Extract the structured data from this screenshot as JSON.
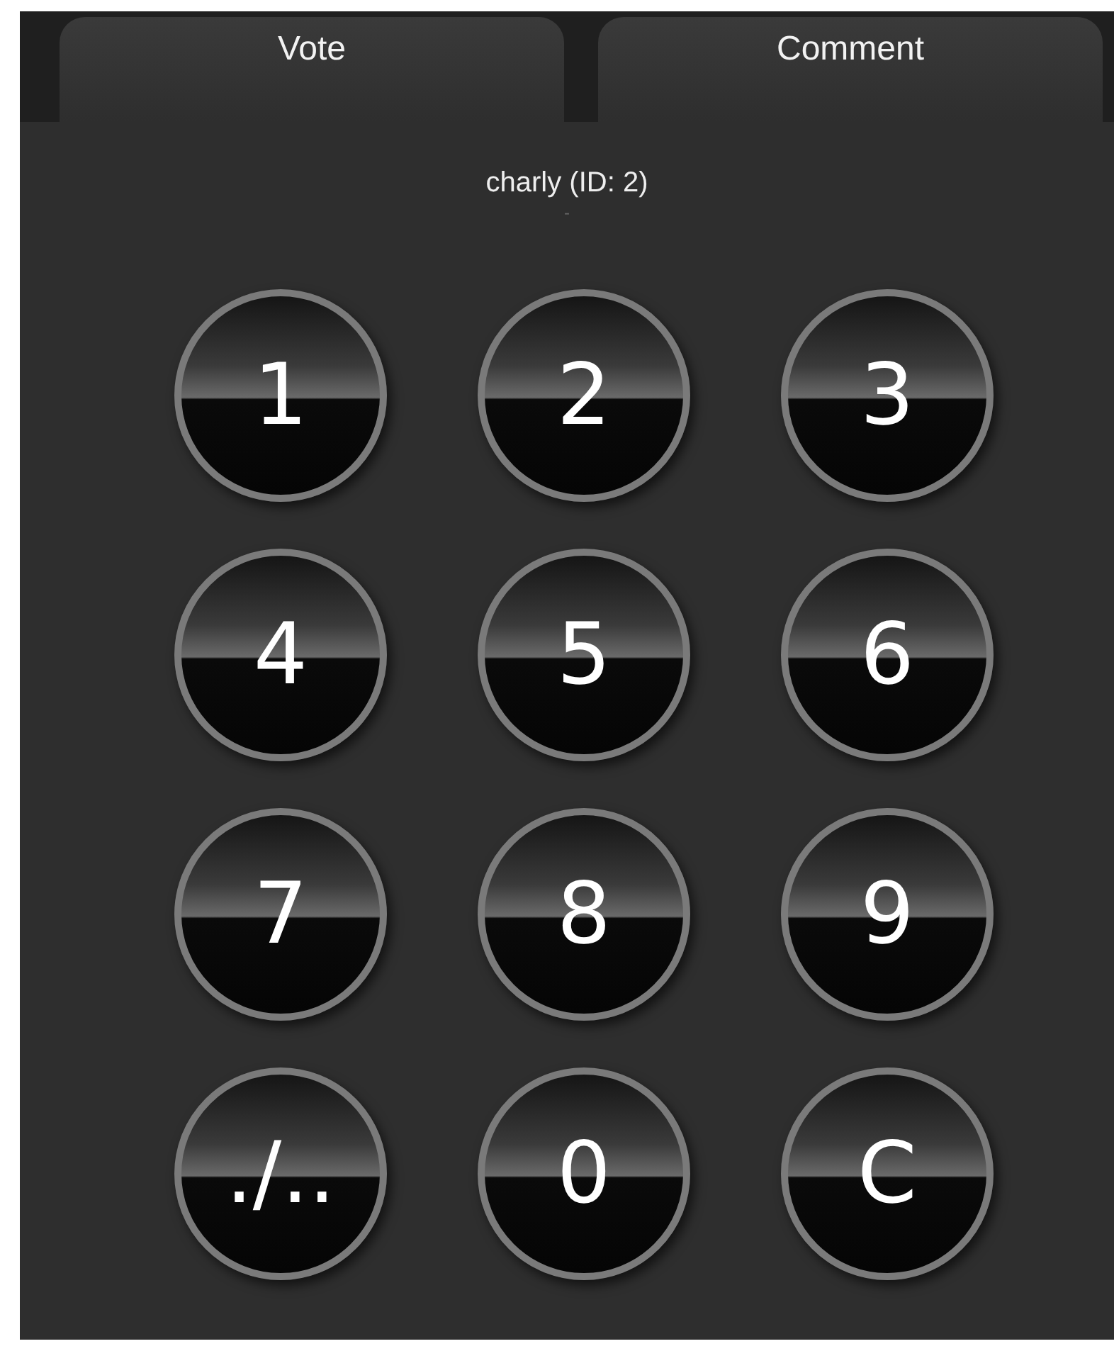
{
  "tabs": [
    {
      "label": "Vote",
      "selected": false
    },
    {
      "label": "Comment",
      "selected": false
    }
  ],
  "user": "charly (ID: 2)",
  "status": "-",
  "keypad": [
    "1",
    "2",
    "3",
    "4",
    "5",
    "6",
    "7",
    "8",
    "9",
    "./..",
    "0",
    "C"
  ]
}
